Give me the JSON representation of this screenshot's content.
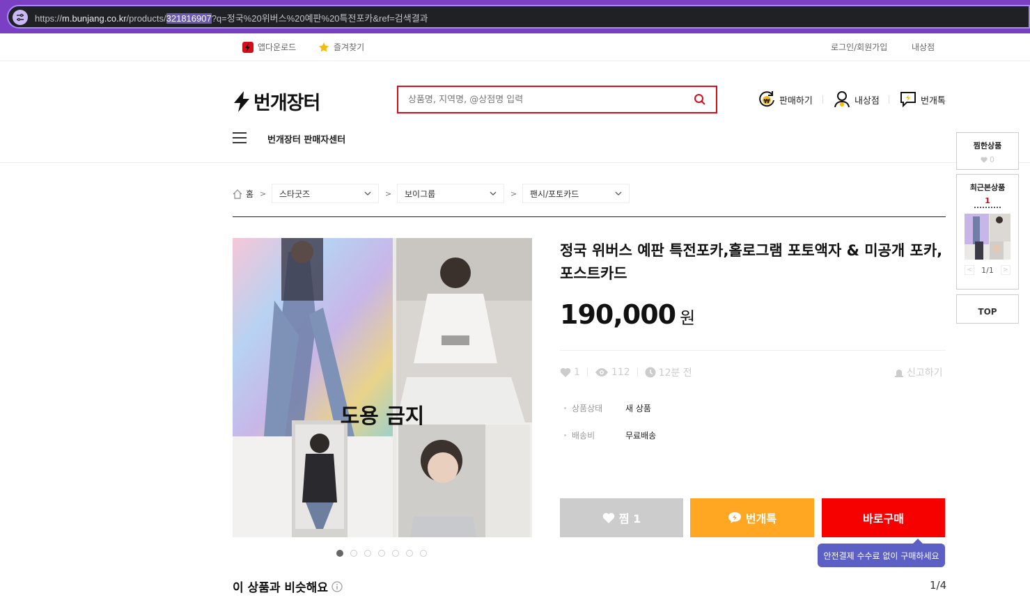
{
  "browser": {
    "url_prefix": "https://",
    "url_host": "m.bunjang.co.kr",
    "url_path": "/products/",
    "url_highlight": "321816907",
    "url_query": "?q=정국%20위버스%20예판%20특전포카&ref=검색결과"
  },
  "util": {
    "app_download": "앱다운로드",
    "bookmark": "즐겨찾기",
    "login": "로그인/회원가입",
    "my_shop": "내상점"
  },
  "header": {
    "logo_text": "번개장터",
    "search_placeholder": "상품명, 지역명, @상점명 입력",
    "sell": "판매하기",
    "my_shop": "내상점",
    "talk": "번개톡",
    "seller_center": "번개장터 판매자센터"
  },
  "breadcrumb": {
    "home": "홈",
    "cat1": "스타굿즈",
    "cat2": "보이그룹",
    "cat3": "팬시/포토카드"
  },
  "product": {
    "title": "정국 위버스 예판 특전포카,홀로그램 포토액자 & 미공개 포카, 포스트카드",
    "price": "190,000",
    "price_unit": "원",
    "likes": "1",
    "views": "112",
    "time_ago": "12분 전",
    "report": "신고하기",
    "image_watermark": "도용 금지",
    "image_count": 7,
    "attrs": [
      {
        "key": "상품상태",
        "value": "새 상품"
      },
      {
        "key": "배송비",
        "value": "무료배송"
      }
    ]
  },
  "actions": {
    "like": "찜 1",
    "talk": "번개톡",
    "buy": "바로구매",
    "tooltip": "안전결제 수수료 없이 구매하세요"
  },
  "similar": {
    "title": "이 상품과 비슷해요",
    "page": "1/4"
  },
  "side": {
    "wish_title": "찜한상품",
    "wish_count": "0",
    "recent_title": "최근본상품",
    "recent_count": "1",
    "recent_page": "1/1",
    "top": "TOP"
  },
  "colors": {
    "brand_red": "#d80c18",
    "buy_red": "#f70000",
    "talk_orange": "#ffa723",
    "like_gray": "#cccccc",
    "tooltip_purple": "#5c5fc4"
  }
}
